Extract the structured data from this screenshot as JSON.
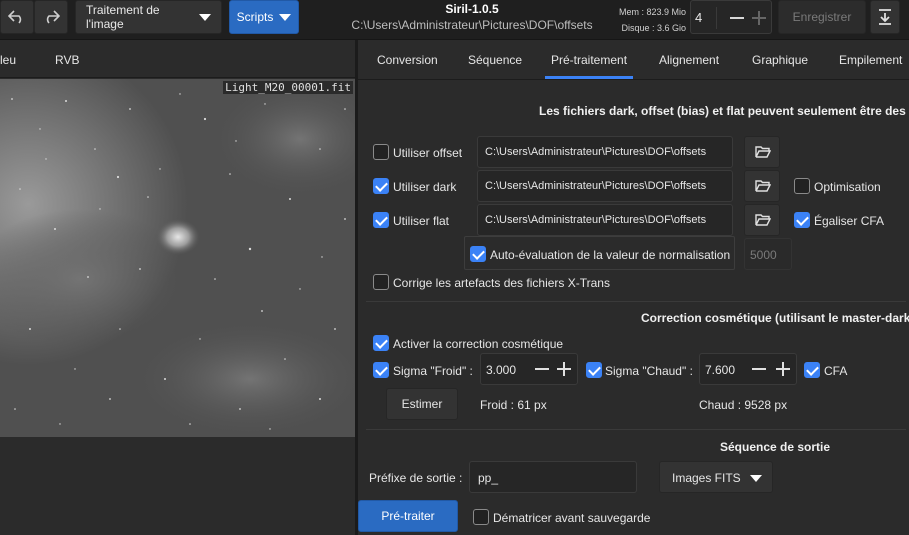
{
  "header": {
    "undo_icon": "undo-icon",
    "redo_icon": "redo-icon",
    "image_menu_label": "Traitement de l'image",
    "scripts_menu_label": "Scripts",
    "app_title": "Siril-1.0.5",
    "working_dir": "C:\\Users\\Administrateur\\Pictures\\DOF\\offsets",
    "mem_label": "Mem : 823.9 Mio",
    "disk_label": "Disque : 3.6 Gio",
    "threads_value": "4",
    "save_label": "Enregistrer",
    "download_icon": "download-icon"
  },
  "left_panel": {
    "tabs": [
      "leu",
      "RVB"
    ],
    "file_label": "Light_M20_00001.fit"
  },
  "right_panel": {
    "tabs": [
      "Conversion",
      "Séquence",
      "Pré-traitement",
      "Alignement",
      "Graphique",
      "Empilement"
    ],
    "active_tab": "Pré-traitement",
    "info_text": "Les fichiers dark, offset (bias) et flat peuvent seulement être des fich",
    "offset": {
      "label": "Utiliser offset",
      "checked": false,
      "path": "C:\\Users\\Administrateur\\Pictures\\DOF\\offsets"
    },
    "dark": {
      "label": "Utiliser dark",
      "checked": true,
      "path": "C:\\Users\\Administrateur\\Pictures\\DOF\\offsets"
    },
    "flat": {
      "label": "Utiliser flat",
      "checked": true,
      "path": "C:\\Users\\Administrateur\\Pictures\\DOF\\offsets"
    },
    "optimisation_label": "Optimisation",
    "egaliser_cfa_label": "Égaliser CFA",
    "auto_eval_label": "Auto-évaluation de la valeur de normalisation",
    "normalisation_value": "5000",
    "xtrans_label": "Corrige les artefacts des fichiers X-Trans",
    "cosmetic_title": "Correction cosmétique (utilisant le master-dark)",
    "cosmetic_enable_label": "Activer la correction cosmétique",
    "sigma_cold_label": "Sigma \"Froid\" :",
    "sigma_cold_value": "3.000",
    "sigma_hot_label": "Sigma \"Chaud\" :",
    "sigma_hot_value": "7.600",
    "cfa_label": "CFA",
    "estimate_label": "Estimer",
    "cold_result": "Froid : 61 px",
    "hot_result": "Chaud : 9528 px",
    "output_title": "Séquence de sortie",
    "prefix_label": "Préfixe de sortie :",
    "prefix_value": "pp_",
    "format_value": "Images FITS",
    "preprocess_label": "Pré-traiter",
    "debayer_label": "Dématricer avant sauvegarde"
  },
  "colors": {
    "accent": "#3b82f6",
    "primary_button": "#2a6bc2",
    "background": "#2b2b2b"
  }
}
